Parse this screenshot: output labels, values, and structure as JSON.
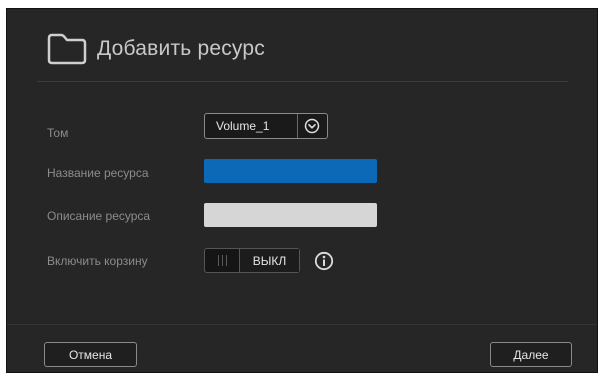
{
  "dialog": {
    "title": "Добавить ресурс",
    "icon": "folder-icon"
  },
  "form": {
    "volume": {
      "label": "Том",
      "value": "Volume_1",
      "icon": "chevron-down-circle-icon"
    },
    "share_name": {
      "label": "Название ресурса",
      "value": "",
      "focused": true
    },
    "share_description": {
      "label": "Описание ресурса",
      "value": ""
    },
    "recycle_bin": {
      "label": "Включить корзину",
      "state_label": "ВЫКЛ",
      "enabled": false,
      "info_icon": "info-icon"
    }
  },
  "footer": {
    "cancel_label": "Отмена",
    "next_label": "Далее"
  },
  "colors": {
    "dialog_bg": "#262626",
    "accent_blue": "#0c69b8",
    "label_gray": "#8c8c8c"
  }
}
